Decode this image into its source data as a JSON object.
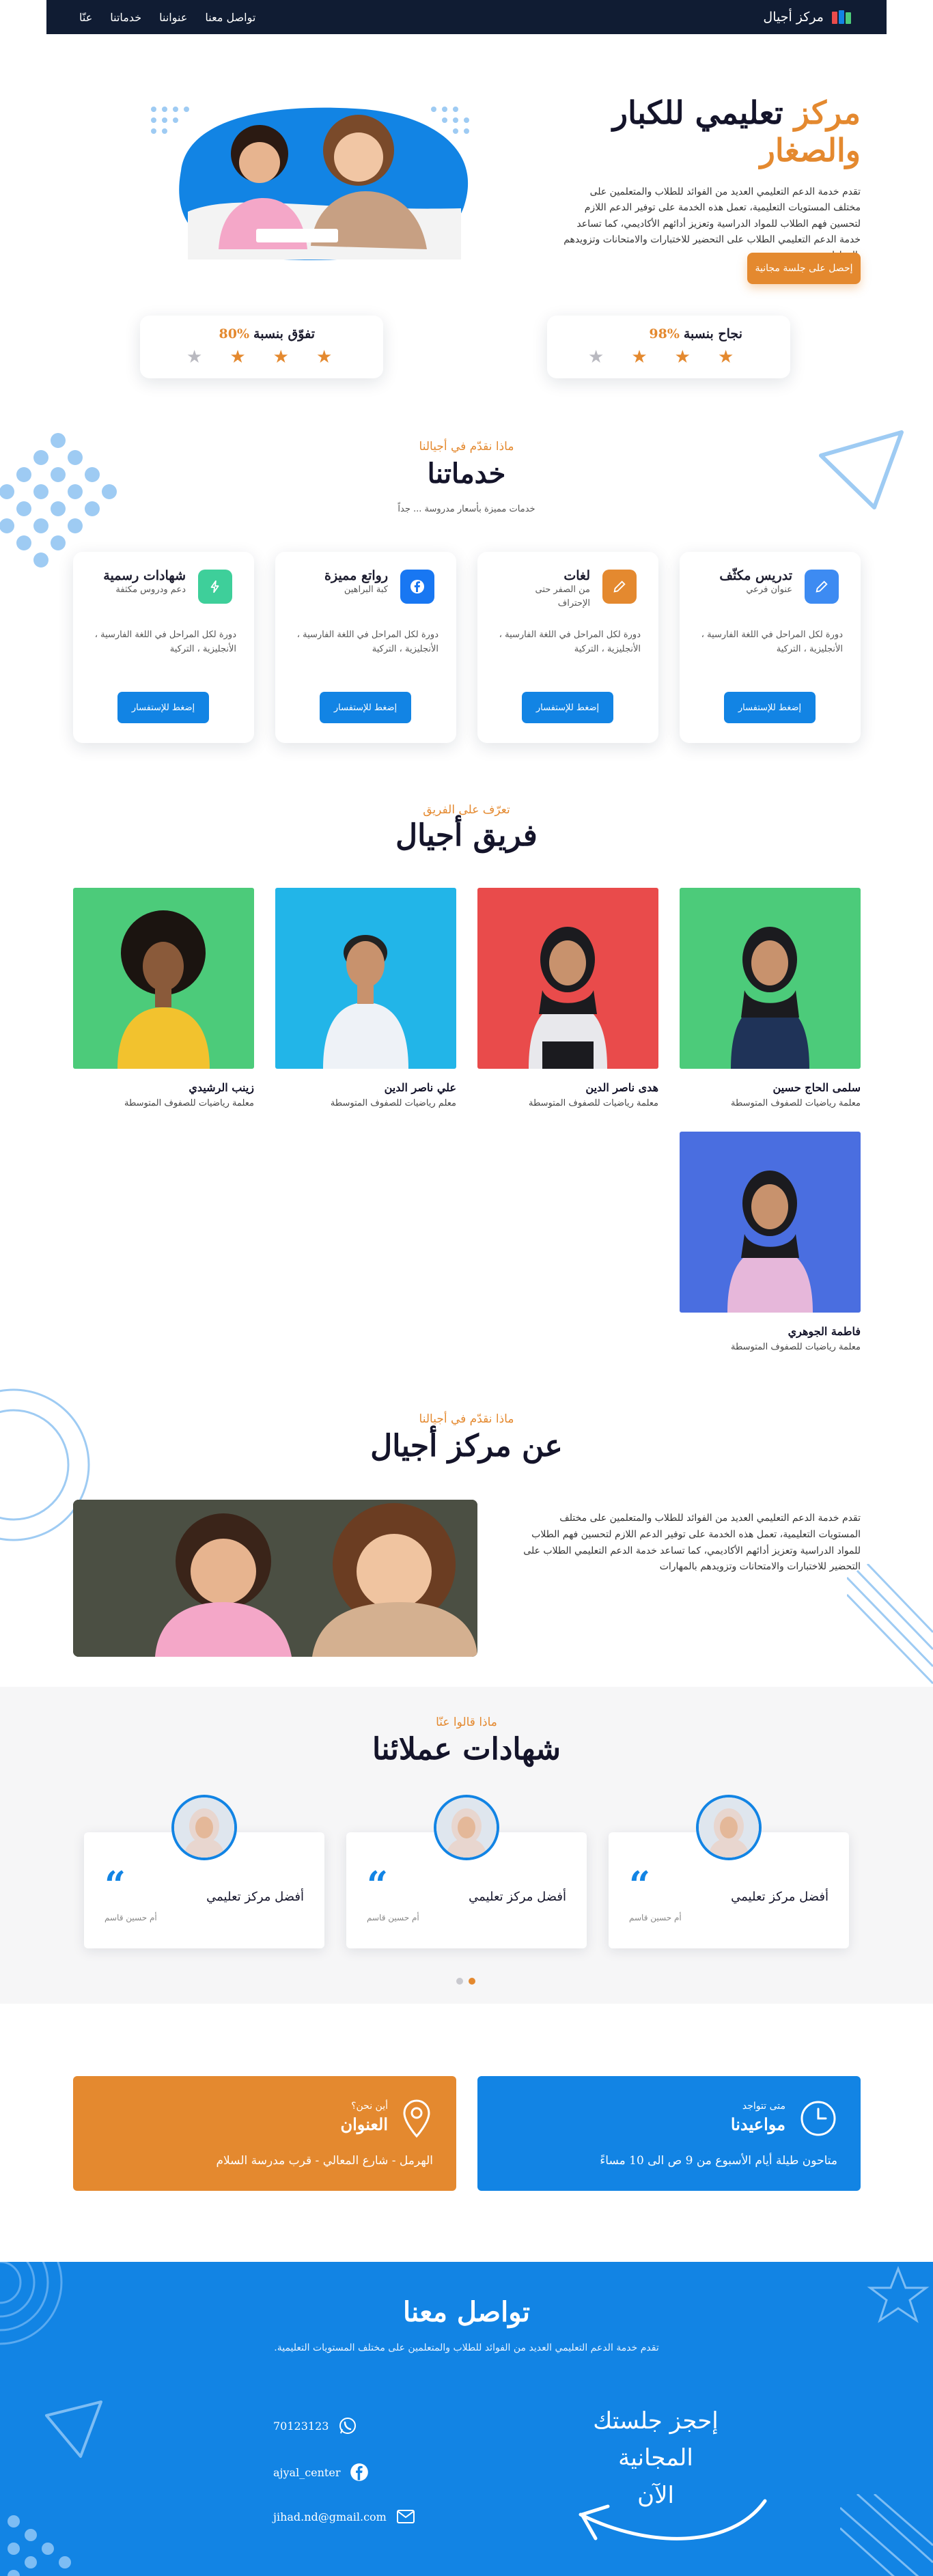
{
  "nav": {
    "brand": "مركز أجيال",
    "links": [
      "عنّا",
      "خدماتنا",
      "عنواننا",
      "تواصل معنا"
    ]
  },
  "hero": {
    "title_1": "مركز",
    "title_2": "تعليمي للكبار",
    "title_3": "والصغار",
    "body": "تقدم خدمة الدعم التعليمي العديد من الفوائد للطلاب والمتعلمين على مختلف المستويات التعليمية، تعمل هذه الخدمة على توفير الدعم اللازم لتحسين فهم الطلاب للمواد الدراسية وتعزيز أدائهم الأكاديمي، كما تساعد خدمة الدعم التعليمي الطلاب على التحضير للاختبارات والامتحانات وتزويدهم بالمهارات",
    "cta": "إحصل على جلسة مجانية"
  },
  "stats": [
    {
      "label": "نجاح بنسبة",
      "value": "98%",
      "stars": 3
    },
    {
      "label": "تفوّق بنسبة",
      "value": "80%",
      "stars": 3
    }
  ],
  "services": {
    "eyebrow": "ماذا نقدّم في أجيالنا",
    "title": "خدماتنا",
    "subtitle": "خدمات مميزة بأسعار مدروسة ... جداً",
    "items": [
      {
        "title": "تدريس مكثّف",
        "sub": "عنوان فرعي",
        "body": "دورة لكل المراحل في اللغة الفارسية ، الأنجليزية ، التركية",
        "button": "إضغط للإستفسار",
        "icon": "pencil-icon",
        "color": "#3d8bf2"
      },
      {
        "title": "لغات",
        "sub": "من الصفر حتى الإحتراف",
        "body": "دورة لكل المراحل في اللغة الفارسية ، الأنجليزية ، التركية",
        "button": "إضغط للإستفسار",
        "icon": "pencil-icon",
        "color": "#e4892f"
      },
      {
        "title": "رواتع مميزة",
        "sub": "كبة البراهين",
        "body": "دورة لكل المراحل في اللغة الفارسية ، الأنجليزية ، التركية",
        "button": "إضغط للإستفسار",
        "icon": "facebook-icon",
        "color": "#1877f2"
      },
      {
        "title": "شهادات رسمية",
        "sub": "دعم ودروس مكثفة",
        "body": "دورة لكل المراحل في اللغة الفارسية ، الأنجليزية ، التركية",
        "button": "إضغط للإستفسار",
        "icon": "bolt-icon",
        "color": "#3ecf9a"
      }
    ]
  },
  "team": {
    "eyebrow": "تعرّف على الفريق",
    "title": "فريق أجيال",
    "members": [
      {
        "name": "سلمى الحاج حسين",
        "role": "معلمة رياضيات للصفوف المتوسطة",
        "bg": "#4ccb7a"
      },
      {
        "name": "هدى ناصر الدين",
        "role": "معلمة رياضيات للصفوف المتوسطة",
        "bg": "#e94b4b"
      },
      {
        "name": "علي ناصر الدين",
        "role": "معلم رياضيات للصفوف المتوسطة",
        "bg": "#22b5e8"
      },
      {
        "name": "زينب الرشيدي",
        "role": "معلمة رياضيات للصفوف المتوسطة",
        "bg": "#4ccb7a"
      },
      {
        "name": "فاطمة الجوهري",
        "role": "معلمة رياضيات للصفوف المتوسطة",
        "bg": "#4a6ee0"
      }
    ]
  },
  "about": {
    "eyebrow": "ماذا نقدّم في أجيالنا",
    "title": "عن مركز أجيال",
    "body": "تقدم خدمة الدعم التعليمي العديد من الفوائد للطلاب والمتعلمين على مختلف المستويات التعليمية، تعمل هذه الخدمة على توفير الدعم اللازم لتحسين فهم الطلاب للمواد الدراسية وتعزيز أدائهم الأكاديمي، كما تساعد خدمة الدعم التعليمي الطلاب على التحضير للاختبارات والامتحانات وتزويدهم بالمهارات"
  },
  "testimonials": {
    "eyebrow": "ماذا قالوا عنّا",
    "title": "شهادات عملائنا",
    "items": [
      {
        "title": "أفضل مركز تعليمي",
        "author": "أم حسين قاسم"
      },
      {
        "title": "أفضل مركز تعليمي",
        "author": "أم حسين قاسم"
      },
      {
        "title": "أفضل مركز تعليمي",
        "author": "أم حسين قاسم"
      }
    ]
  },
  "info": {
    "hours": {
      "eyebrow": "متى تتواجد",
      "title": "مواعيدنا",
      "body": "متاحون طيلة أيام الأسبوع من 9 ص الى 10 مساءً"
    },
    "address": {
      "eyebrow": "أين نحن؟",
      "title": "العنوان",
      "body": "الهرمل - شارع المعالي - قرب مدرسة السلام"
    }
  },
  "contact": {
    "title": "تواصل معنا",
    "subtitle": "تقدم خدمة الدعم التعليمي العديد من الفوائد للطلاب والمتعلمين على مختلف المستويات التعليمية.",
    "cta_line1": "إحجز جلستك المجانية",
    "cta_line2": "الآن",
    "phone": "70123123",
    "facebook": "ajyal_center",
    "email": "jihad.nd@gmail.com"
  },
  "colors": {
    "orange": "#e4892f",
    "blue": "#1284e4",
    "navy": "#101c33"
  }
}
